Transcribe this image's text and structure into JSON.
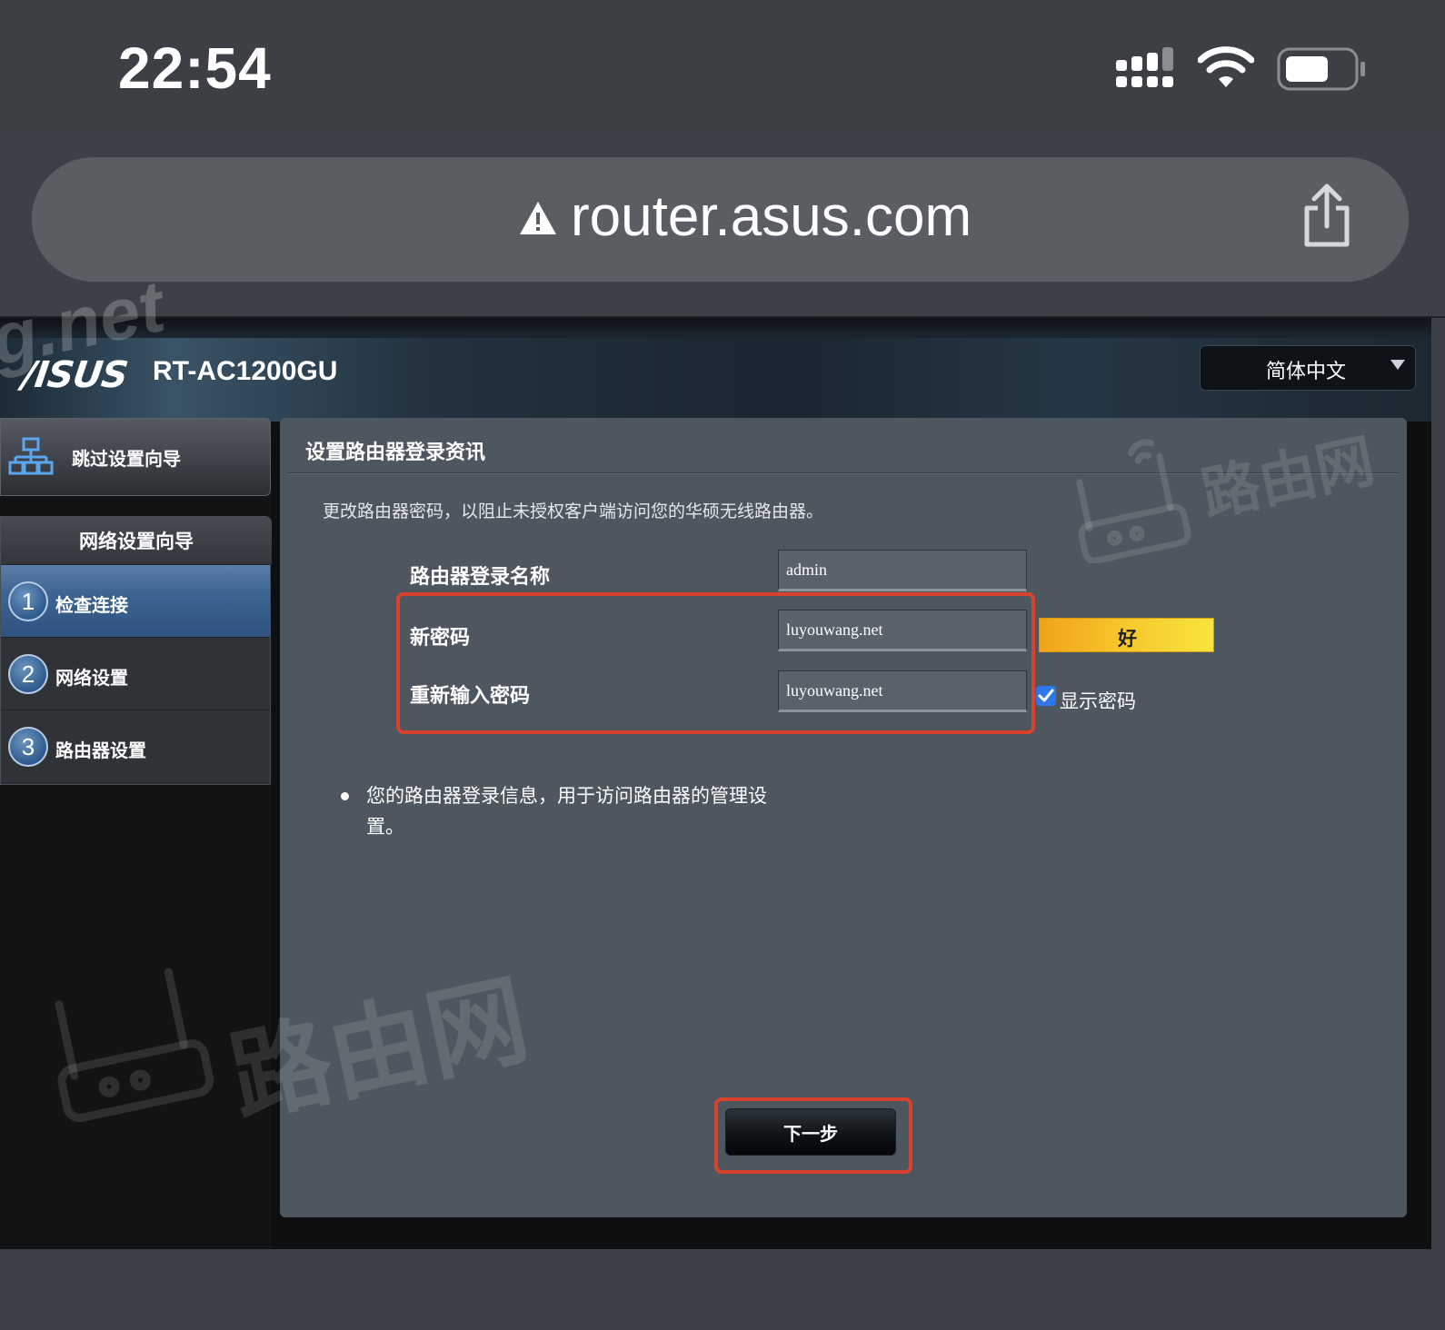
{
  "status_bar": {
    "time": "22:54"
  },
  "browser": {
    "url": "router.asus.com"
  },
  "router_ui": {
    "brand": "/ISUS",
    "model": "RT-AC1200GU",
    "language": "简体中文"
  },
  "sidebar": {
    "skip_wizard": "跳过设置向导",
    "wizard_title": "网络设置向导",
    "steps": [
      {
        "num": "1",
        "label": "检查连接",
        "active": true
      },
      {
        "num": "2",
        "label": "网络设置",
        "active": false
      },
      {
        "num": "3",
        "label": "路由器设置",
        "active": false
      }
    ]
  },
  "panel": {
    "title": "设置路由器登录资讯",
    "description": "更改路由器密码，以阻止未授权客户端访问您的华硕无线路由器。",
    "fields": {
      "username_label": "路由器登录名称",
      "username_value": "admin",
      "new_password_label": "新密码",
      "new_password_value": "luyouwang.net",
      "confirm_password_label": "重新输入密码",
      "confirm_password_value": "luyouwang.net"
    },
    "strength": "好",
    "show_password": {
      "label": "显示密码",
      "checked": true
    },
    "note": "您的路由器登录信息，用于访问路由器的管理设置。",
    "next_button": "下一步"
  },
  "watermarks": {
    "corner": "g.net",
    "brand": "路由网"
  },
  "colors": {
    "highlight": "#d9432e",
    "active_step": "#3d6490",
    "strength": "#f6c52a",
    "checkbox": "#2d77e8"
  }
}
